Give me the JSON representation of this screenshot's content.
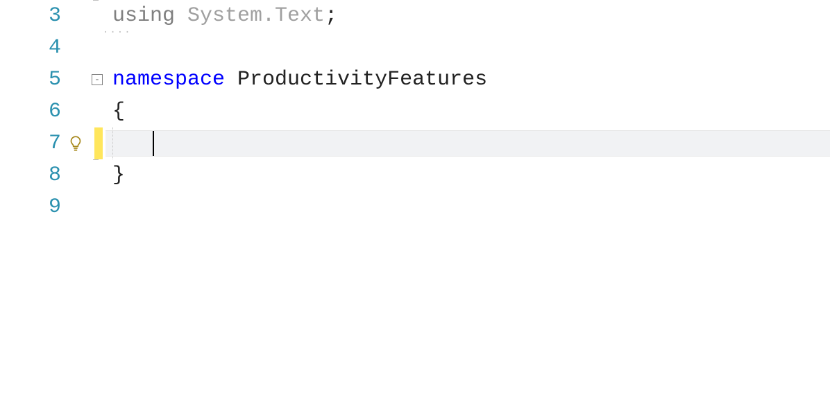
{
  "editor": {
    "colors": {
      "keyword": "#0000ff",
      "type": "#2b91af",
      "line_number": "#2b91af",
      "using_dimmed": "#808080",
      "change_marker": "#ffe65c",
      "current_line_bg": "#f1f2f4"
    },
    "lines": [
      {
        "number": "3",
        "has_fold": false,
        "tokens": {
          "using": "using",
          "ns": "System.Text",
          "semi": ";"
        },
        "region_bracket": "bottom"
      },
      {
        "number": "4",
        "has_fold": false,
        "empty": true
      },
      {
        "number": "5",
        "has_fold": true,
        "fold_symbol": "-",
        "tokens": {
          "namespace_kw": "namespace",
          "namespace_name": "ProductivityFeatures"
        }
      },
      {
        "number": "6",
        "has_fold": false,
        "tokens": {
          "brace": "{"
        },
        "outline_start": true
      },
      {
        "number": "7",
        "has_fold": false,
        "lightbulb": true,
        "change_marker": true,
        "current_line": true,
        "caret": true,
        "indent_guides": true
      },
      {
        "number": "8",
        "has_fold": false,
        "tokens": {
          "brace": "}"
        },
        "outline_end": true
      },
      {
        "number": "9",
        "has_fold": false,
        "empty": true
      }
    ]
  }
}
